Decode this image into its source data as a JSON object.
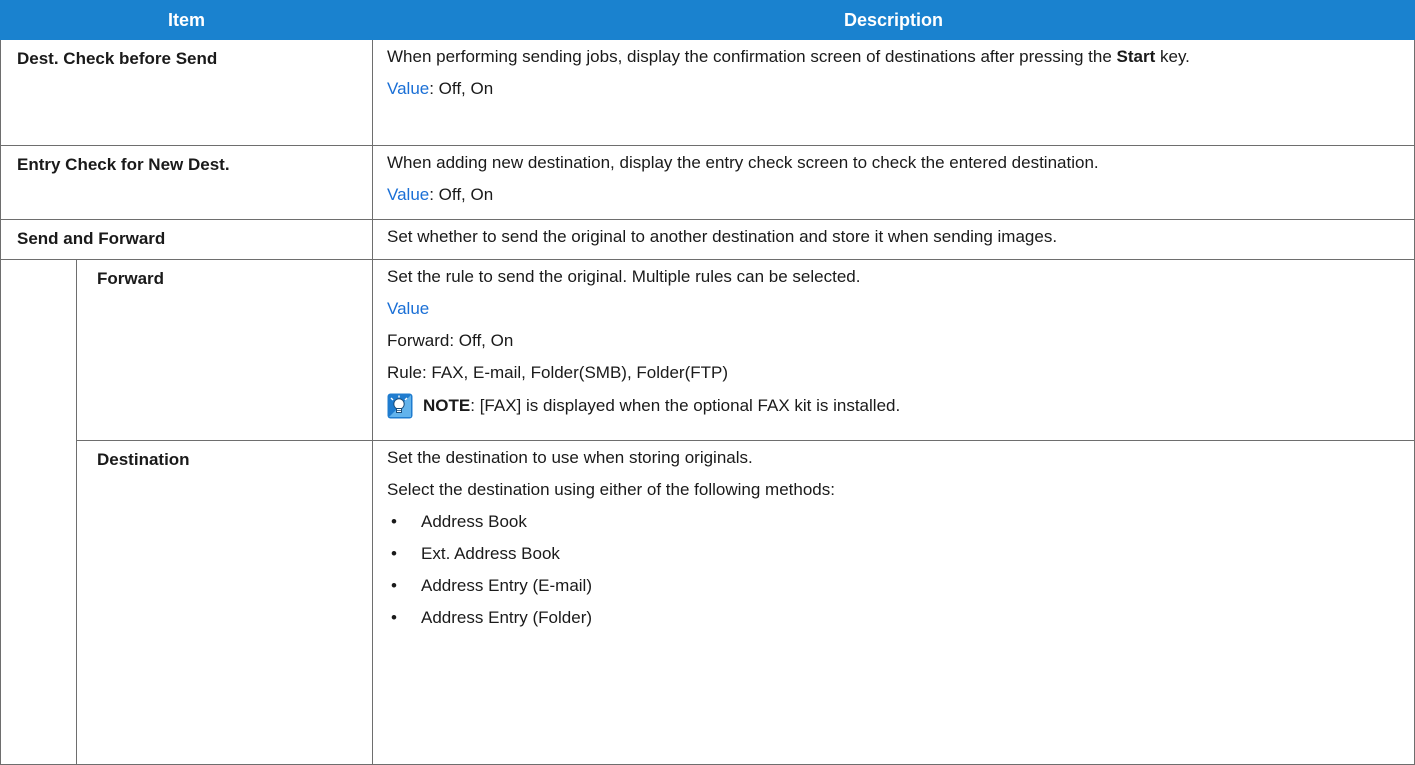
{
  "header": {
    "item": "Item",
    "description": "Description"
  },
  "rows": {
    "dest_check": {
      "item": "Dest. Check before Send",
      "desc_before": "When performing sending jobs, display the confirmation screen of destinations after pressing the ",
      "desc_key": "Start",
      "desc_after": " key.",
      "value_label": "Value",
      "value_text": ": Off, On"
    },
    "entry_check": {
      "item": "Entry Check for New Dest.",
      "desc": "When adding new destination, display the entry check screen to check the entered destination.",
      "value_label": "Value",
      "value_text": ": Off, On"
    },
    "send_forward": {
      "item": "Send and Forward",
      "desc": "Set whether to send the original to another destination and store it when sending images."
    },
    "forward": {
      "item": "Forward",
      "desc": "Set the rule to send the original. Multiple rules can be selected.",
      "value_label": "Value",
      "line1": "Forward: Off, On",
      "line2": "Rule: FAX, E-mail, Folder(SMB), Folder(FTP)",
      "note_label": "NOTE",
      "note_text": ": [FAX] is displayed when the optional FAX kit is installed.",
      "note_icon": "note-icon"
    },
    "destination": {
      "item": "Destination",
      "desc1": "Set the destination to use when storing originals.",
      "desc2": "Select the destination using either of the following methods:",
      "methods": [
        "Address Book",
        "Ext. Address Book",
        "Address Entry (E-mail)",
        "Address Entry (Folder)"
      ],
      "bullet": "•"
    }
  },
  "colors": {
    "header_bg": "#1a82cf",
    "value_link": "#1a6fd6",
    "border": "#6e6e6e"
  }
}
